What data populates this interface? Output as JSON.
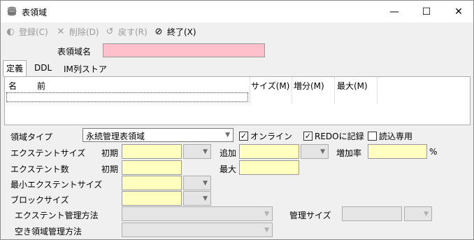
{
  "window": {
    "title": "表領域",
    "icon": "database-icon"
  },
  "titlebar_buttons": {
    "minimize": "—",
    "maximize": "☐",
    "close": "✕"
  },
  "toolbar": {
    "register": "登録(C)",
    "delete": "削除(D)",
    "revert": "戻す(R)",
    "exit": "終了(X)"
  },
  "form": {
    "name_label": "表領域名",
    "name_value": ""
  },
  "tabs": [
    "定義",
    "DDL",
    "IM列ストア"
  ],
  "grid": {
    "columns": [
      "名",
      "前",
      "サイズ(M)",
      "増分(M)",
      "最大(M)"
    ]
  },
  "region_type": {
    "label": "領域タイプ",
    "value": "永続管理表領域",
    "online_label": "オンライン",
    "online_checked": true,
    "redo_label": "REDOに記録",
    "redo_checked": true,
    "readonly_label": "読込専用",
    "readonly_checked": false
  },
  "extent_size": {
    "label": "エクステントサイズ",
    "initial_label": "初期",
    "add_label": "追加",
    "growth_label": "増加率",
    "percent": "%"
  },
  "extent_count": {
    "label": "エクステント数",
    "initial_label": "初期",
    "max_label": "最大"
  },
  "min_extent_size": {
    "label": "最小エクステントサイズ"
  },
  "block_size": {
    "label": "ブロックサイズ"
  },
  "extent_mgmt": {
    "label": "エクステント管理方法",
    "mgmt_size_label": "管理サイズ"
  },
  "free_space_mgmt": {
    "label": "空き領域管理方法"
  },
  "colors": {
    "required": "#ffc0cc",
    "input": "#ffffc0"
  }
}
